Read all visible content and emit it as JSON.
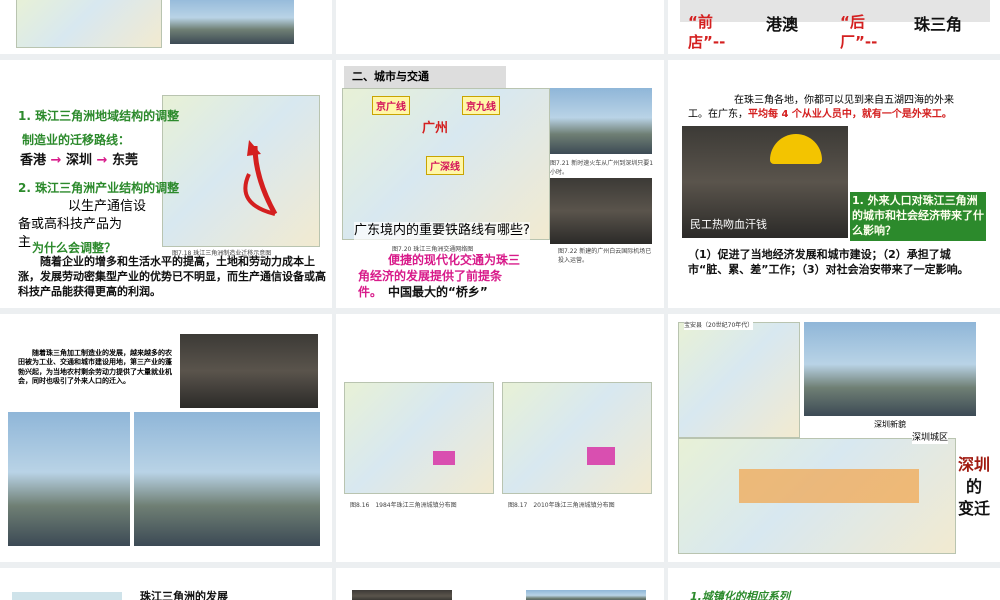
{
  "slides": {
    "top_right": {
      "quote_left_a": "“前",
      "quote_left_b": "店”--",
      "text_a": "港澳",
      "quote_right_a": "“后",
      "quote_right_b": "厂”--",
      "text_b": "珠三角"
    },
    "mid_left": {
      "h1": "1. 珠江三角洲地域结构的调整",
      "h1_sub": "制造业的迁移路线：",
      "route": [
        "香港",
        "深圳",
        "东莞"
      ],
      "h2": "2. 珠江三角洲产业结构的调整",
      "h2_body_a": "以生产通信设",
      "h2_body_b": "备或高科技产品为",
      "h2_body_c": "主",
      "question": "为什么会调整？",
      "paragraph": "随着企业的增多和生活水平的提高，土地和劳动力成本上涨，发展劳动密集型产业的优势已不明显，而生产通信设备或高科技产品能获得更高的利润。",
      "map_caption": "图7.18 珠江三角洲制造业迁移示意图"
    },
    "mid_center": {
      "section_title": "二、城市与交通",
      "rail_1": "京广线",
      "rail_2": "京九线",
      "rail_3": "广深线",
      "city": "广州",
      "question": "广东境内的重要铁路线有哪些?",
      "map_caption": "图7.20 珠江三角洲交通网络图",
      "photo1_caption": "图7.21 新时速火车从广州到深圳只要1小时。",
      "photo2_caption": "图7.22 新建的广州白云国际机场已投入运营。",
      "conclusion_a": "便捷的现代化交通为珠三",
      "conclusion_b": "角经济的发展提供了前提条",
      "conclusion_c": "件。",
      "hometown": "中国最大的“桥乡”"
    },
    "mid_right": {
      "intro_a": "在珠三角各地，你都可以见到来自五湖四海的外来",
      "intro_b": "工。在广东，",
      "intro_highlight": "平均每 4 个从业人员中，就有一个是外来工。",
      "photo_caption": "民工热吻血汗钱",
      "question": "1. 外来人口对珠江三角洲的城市和社会经济带来了什么影响？",
      "answer": "（1）促进了当地经济发展和城市建设；（2）承担了城市“脏、累、差”工作；（3）对社会治安带来了一定影响。"
    },
    "bottom_left": {
      "paragraph": "随着珠三角加工制造业的发展，越来越多的农田被为工业、交通和城市建设用地，第三产业的蓬勃兴起，为当地农村剩余劳动力提供了大量就业机会，同时也吸引了外来人口的迁入。"
    },
    "bottom_center": {
      "caption_left": "图8.16　1984年珠江三角洲城镇分布图",
      "caption_right": "图8.17　2010年珠江三角洲城镇分布图"
    },
    "bottom_right": {
      "old_label": "宝安县（20世纪70年代）",
      "new_label": "深圳新貌",
      "area_label": "深圳城区",
      "title_a": "深圳",
      "title_b": "的",
      "title_c": "变迁"
    },
    "last_left": {
      "text": "珠江三角洲的发展"
    },
    "last_right": {
      "text": "1.城镇化的相应系列"
    }
  }
}
